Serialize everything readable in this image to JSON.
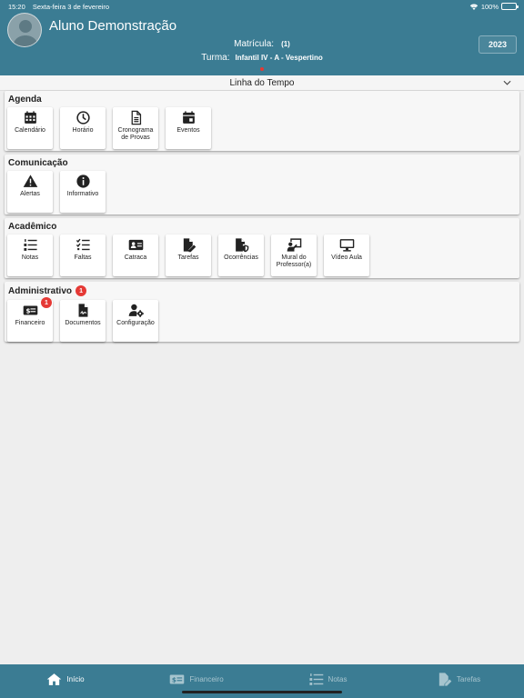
{
  "status_bar": {
    "time": "15:20",
    "date": "Sexta-feira 3 de fevereiro",
    "battery": "100%"
  },
  "header": {
    "student_name": "Aluno Demonstração",
    "enrollment_label": "Matrícula:",
    "enrollment_value": "(1)",
    "class_label": "Turma:",
    "class_value": "Infantil IV - A - Vespertino",
    "year": "2023"
  },
  "timeline": {
    "label": "Linha do Tempo"
  },
  "sections": {
    "agenda": {
      "title": "Agenda",
      "tiles": [
        {
          "label": "Calendário",
          "icon": "calendar-icon"
        },
        {
          "label": "Horário",
          "icon": "clock-icon"
        },
        {
          "label": "Cronograma de Provas",
          "icon": "document-icon"
        },
        {
          "label": "Eventos",
          "icon": "calendar-event-icon"
        }
      ]
    },
    "comunicacao": {
      "title": "Comunicação",
      "tiles": [
        {
          "label": "Alertas",
          "icon": "warning-icon"
        },
        {
          "label": "Informativo",
          "icon": "info-icon"
        }
      ]
    },
    "academico": {
      "title": "Acadêmico",
      "tiles": [
        {
          "label": "Notas",
          "icon": "numbered-list-icon"
        },
        {
          "label": "Faltas",
          "icon": "checklist-icon"
        },
        {
          "label": "Catraca",
          "icon": "id-card-icon"
        },
        {
          "label": "Tarefas",
          "icon": "file-edit-icon"
        },
        {
          "label": "Ocorrências",
          "icon": "file-shield-icon"
        },
        {
          "label": "Mural do Professor(a)",
          "icon": "teacher-board-icon"
        },
        {
          "label": "Vídeo Aula",
          "icon": "monitor-icon"
        }
      ]
    },
    "administrativo": {
      "title": "Administrativo",
      "badge": "1",
      "tiles": [
        {
          "label": "Financeiro",
          "icon": "money-icon",
          "badge": "1"
        },
        {
          "label": "Documentos",
          "icon": "file-signature-icon"
        },
        {
          "label": "Configuração",
          "icon": "user-gear-icon"
        }
      ]
    }
  },
  "bottom_nav": [
    {
      "label": "Início",
      "icon": "home-icon",
      "active": true
    },
    {
      "label": "Financeiro",
      "icon": "money-icon"
    },
    {
      "label": "Notas",
      "icon": "numbered-list-icon"
    },
    {
      "label": "Tarefas",
      "icon": "file-edit-icon"
    }
  ],
  "colors": {
    "header": "#3b7c93",
    "badge": "#e53935",
    "background": "#eeeeee"
  }
}
